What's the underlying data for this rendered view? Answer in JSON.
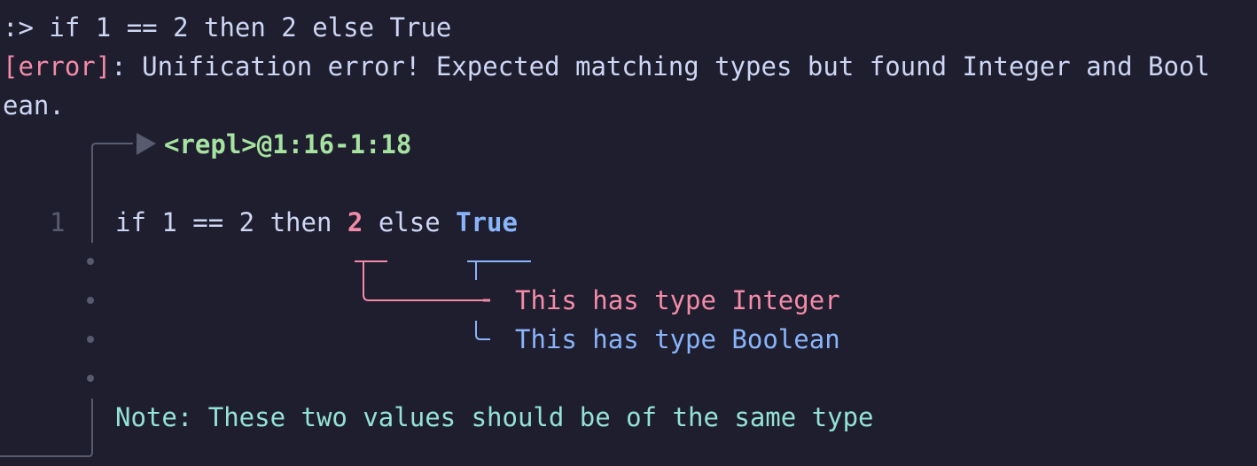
{
  "prompt": {
    "symbol": ":>",
    "command": "if 1 == 2 then 2 else True"
  },
  "error": {
    "tag": "[error]",
    "message_line1": ": Unification error! Expected matching types but found Integer and Bool",
    "message_line2": "ean."
  },
  "location": "<repl>@1:16-1:18",
  "source": {
    "line_number": "1",
    "before": "if 1 == 2 then ",
    "first_value": "2",
    "middle": " else ",
    "second_value": "True"
  },
  "labels": {
    "first": "This has type Integer",
    "second": "This has type Boolean"
  },
  "note": "Note: These two values should be of the same type",
  "colors": {
    "background": "#1e1e2e",
    "text": "#cdd6f4",
    "error": "#f38ba8",
    "location": "#a6e3a1",
    "integer": "#f38ba8",
    "boolean": "#89b4fa",
    "note": "#94e2d5",
    "gutter": "#585b70"
  }
}
